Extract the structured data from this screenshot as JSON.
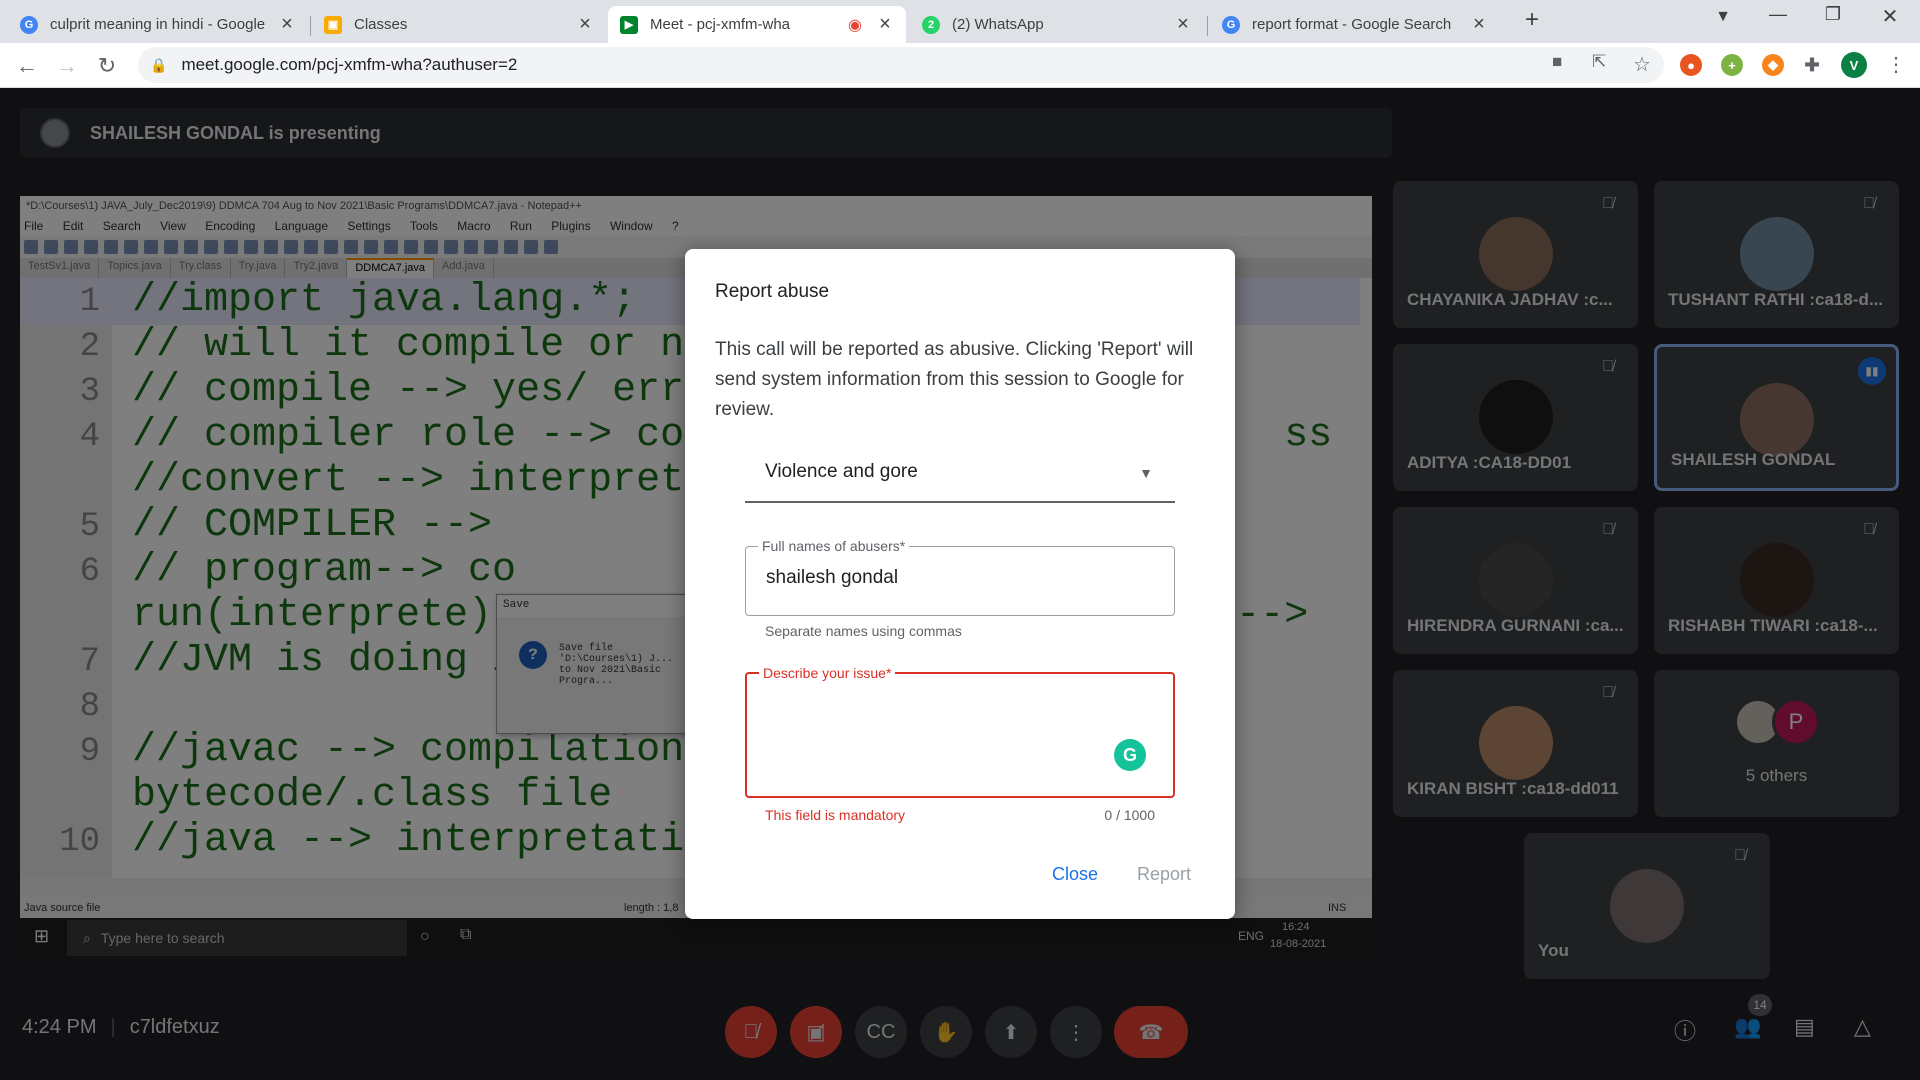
{
  "browser": {
    "tabs": [
      {
        "title": "culprit meaning in hindi - Google",
        "icon": "google-icon",
        "color": "#4285f4"
      },
      {
        "title": "Classes",
        "icon": "classroom-icon",
        "color": "#f9ab00"
      },
      {
        "title": "Meet - pcj-xmfm-wha",
        "icon": "meet-icon",
        "color": "#00832d",
        "active": true
      },
      {
        "title": "(2) WhatsApp",
        "icon": "whatsapp-icon",
        "color": "#25d366"
      },
      {
        "title": "report format - Google Search",
        "icon": "google-icon",
        "color": "#4285f4"
      }
    ],
    "url": "meet.google.com/pcj-xmfm-wha?authuser=2",
    "profile_initial": "V"
  },
  "presenting": {
    "text": "SHAILESH GONDAL is presenting"
  },
  "notepad": {
    "title": "*D:\\Courses\\1) JAVA_July_Dec2019\\9) DDMCA 704 Aug to Nov 2021\\Basic Programs\\DDMCA7.java - Notepad++",
    "menu": [
      "File",
      "Edit",
      "Search",
      "View",
      "Encoding",
      "Language",
      "Settings",
      "Tools",
      "Macro",
      "Run",
      "Plugins",
      "Window",
      "?"
    ],
    "tabs": [
      "TestSv1.java",
      "Topics.java",
      "Try.class",
      "Try.java",
      "Try2.java",
      "DDMCA7.java",
      "Add.java"
    ],
    "lines": [
      {
        "n": "1",
        "t": "//import java.lang.*;"
      },
      {
        "n": "2",
        "t": "// will it compile or n"
      },
      {
        "n": "3",
        "t": "// compile --> yes/ err"
      },
      {
        "n": "4",
        "t": "// compiler role --> co                         ss"
      },
      {
        "n": "",
        "t": "//convert --> interprete"
      },
      {
        "n": "5",
        "t": "// COMPILER -->"
      },
      {
        "n": "6",
        "t": "// program--> co"
      },
      {
        "n": "",
        "t": "run(interprete)-                              -->"
      },
      {
        "n": "7",
        "t": "//JVM is doing interpret"
      },
      {
        "n": "8",
        "t": ""
      },
      {
        "n": "9",
        "t": "//javac --> compilation"
      },
      {
        "n": "",
        "t": "bytecode/.class file"
      },
      {
        "n": "10",
        "t": "//java --> interpretati"
      }
    ],
    "status_left": "Java source file",
    "status_length": "length : 1,8",
    "status_ins": "INS",
    "save_dialog": {
      "title": "Save",
      "text": "Save file 'D:\\Courses\\1) J... to Nov 2021\\Basic Progra..."
    }
  },
  "taskbar": {
    "search": "Type here to search",
    "lang": "ENG",
    "time": "16:24",
    "date": "18-08-2021"
  },
  "participants": [
    {
      "name": "CHAYANIKA JADHAV :c...",
      "muted": true
    },
    {
      "name": "TUSHANT RATHI :ca18-d...",
      "muted": true
    },
    {
      "name": "ADITYA :CA18-DD01",
      "muted": true
    },
    {
      "name": "SHAILESH GONDAL",
      "speaking": true
    },
    {
      "name": "HIRENDRA GURNANI :ca...",
      "muted": true
    },
    {
      "name": "RISHABH TIWARI :ca18-...",
      "muted": true
    },
    {
      "name": "KIRAN BISHT :ca18-dd011",
      "muted": true
    },
    {
      "name": "5 others",
      "initial": "P"
    },
    {
      "name": "You",
      "muted": true
    }
  ],
  "bottom": {
    "time": "4:24 PM",
    "code": "c7ldfetxuz",
    "people_count": "14"
  },
  "dialog": {
    "title": "Report abuse",
    "description": "This call will be reported as abusive. Clicking 'Report' will send system information from this session to Google for review.",
    "category": "Violence and gore",
    "names_label": "Full names of abusers*",
    "names_value": "shailesh gondal",
    "names_hint": "Separate names using commas",
    "issue_label": "Describe your issue*",
    "issue_error": "This field is mandatory",
    "issue_count": "0 / 1000",
    "close": "Close",
    "report": "Report"
  },
  "colors": {
    "accent": "#1a73e8",
    "error": "#d93025",
    "hangup": "#ea4335"
  }
}
